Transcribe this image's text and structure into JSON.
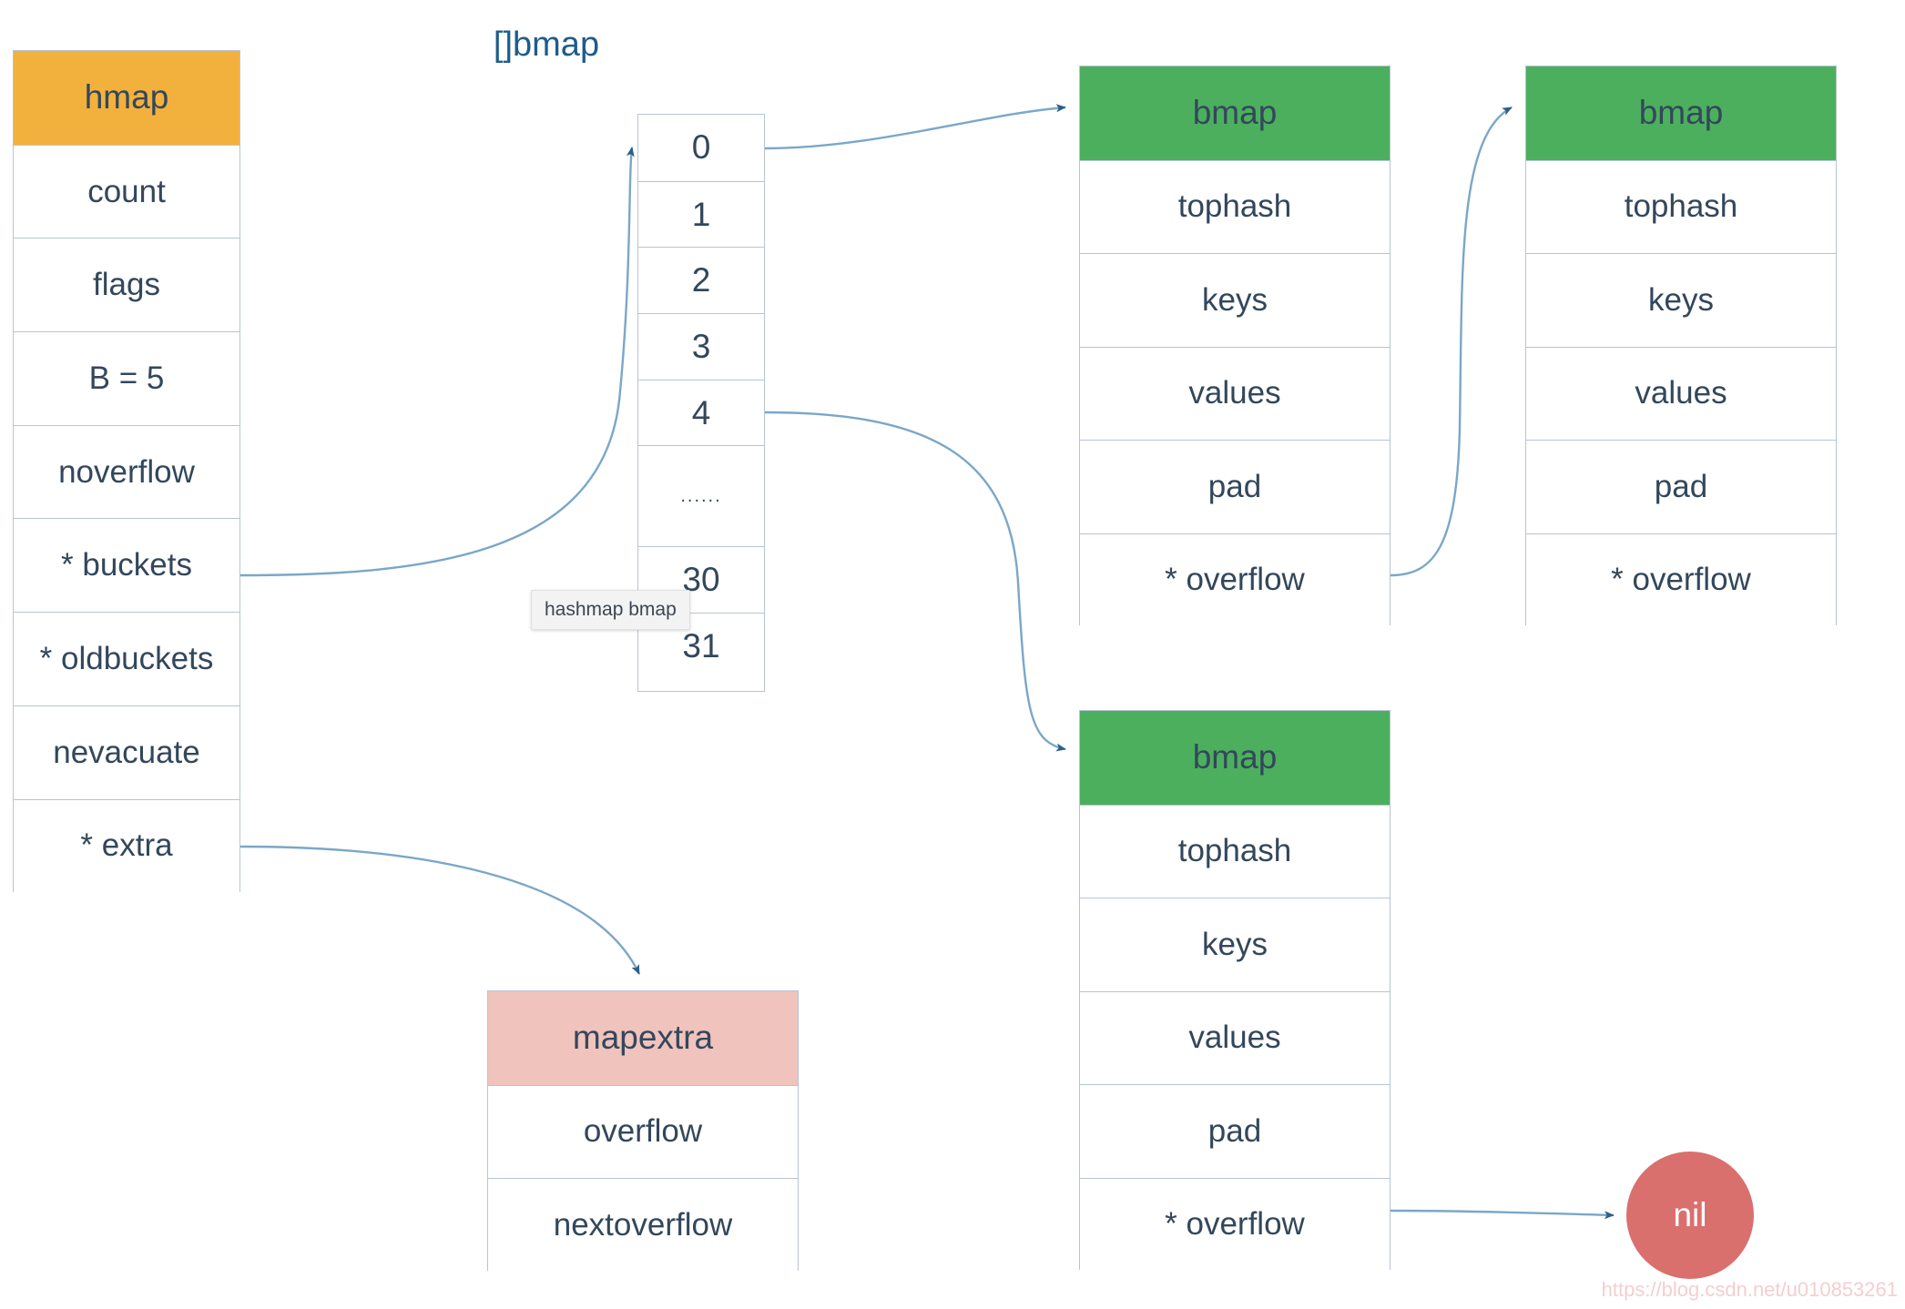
{
  "diagram": {
    "title": "Go hashmap (hmap) memory layout",
    "colors": {
      "hmap_header": "#f2b13c",
      "bmap_header": "#4caf5d",
      "mapextra_header": "#f0c3bd",
      "nil_node": "#d9706e",
      "text": "#33475b",
      "array_title": "#1f5c8b",
      "border": "#b8c4d4",
      "arrow": "#7ba7c7",
      "arrow_head": "#2e5f87"
    }
  },
  "hmap": {
    "header": "hmap",
    "fields": [
      "count",
      "flags",
      "B = 5",
      "noverflow",
      "* buckets",
      "* oldbuckets",
      "nevacuate",
      "* extra"
    ]
  },
  "bmap_array": {
    "title": "[]bmap",
    "cells": [
      "0",
      "1",
      "2",
      "3",
      "4",
      "......",
      "30",
      "31"
    ]
  },
  "bmaps": [
    {
      "id": "bmap1",
      "header": "bmap",
      "fields": [
        "tophash",
        "keys",
        "values",
        "pad",
        "* overflow"
      ]
    },
    {
      "id": "bmap2",
      "header": "bmap",
      "fields": [
        "tophash",
        "keys",
        "values",
        "pad",
        "* overflow"
      ]
    },
    {
      "id": "bmap3",
      "header": "bmap",
      "fields": [
        "tophash",
        "keys",
        "values",
        "pad",
        "* overflow"
      ]
    }
  ],
  "mapextra": {
    "header": "mapextra",
    "fields": [
      "overflow",
      "nextoverflow"
    ]
  },
  "nil_node": {
    "label": "nil"
  },
  "tooltip": {
    "text": "hashmap bmap"
  },
  "watermark": {
    "text": "https://blog.csdn.net/u010853261"
  }
}
